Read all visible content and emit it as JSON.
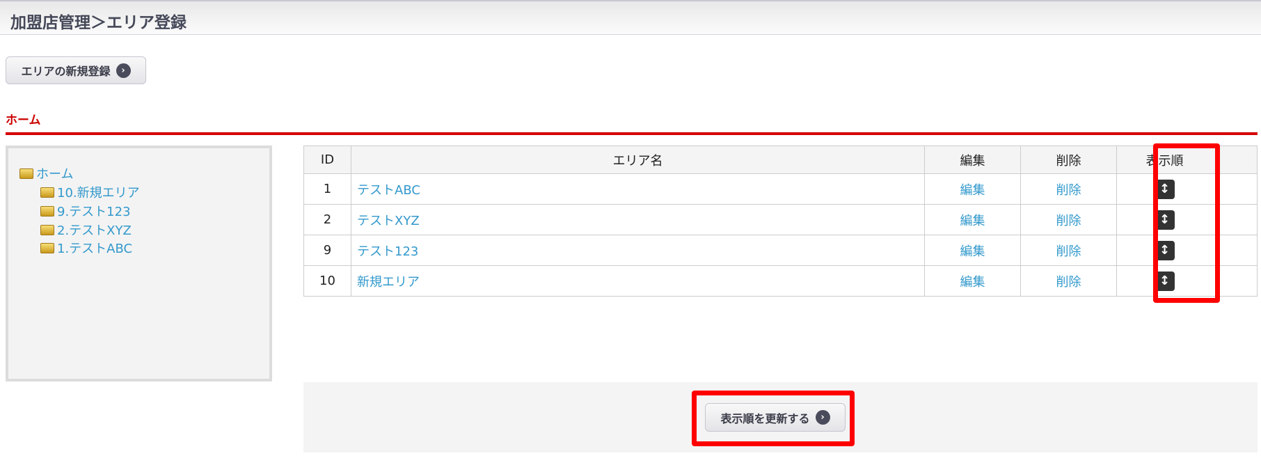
{
  "header": {
    "title": "加盟店管理＞エリア登録"
  },
  "new_button": {
    "label": "エリアの新規登録"
  },
  "section_title": "ホーム",
  "tree": {
    "root": "ホーム",
    "children": [
      "10.新規エリア",
      "9.テスト123",
      "2.テストXYZ",
      "1.テストABC"
    ]
  },
  "table": {
    "headers": [
      "ID",
      "エリア名",
      "編集",
      "削除",
      "表示順"
    ],
    "rows": [
      {
        "id": "1",
        "name": "テストABC",
        "edit": "編集",
        "delete": "削除"
      },
      {
        "id": "2",
        "name": "テストXYZ",
        "edit": "編集",
        "delete": "削除"
      },
      {
        "id": "9",
        "name": "テスト123",
        "edit": "編集",
        "delete": "削除"
      },
      {
        "id": "10",
        "name": "新規エリア",
        "edit": "編集",
        "delete": "削除"
      }
    ]
  },
  "update_button": {
    "label": "表示順を更新する"
  },
  "icons": {
    "arrow": "chevron-right-circle-icon",
    "sort": "drag-vertical-icon",
    "folder": "folder-icon"
  },
  "colors": {
    "highlight": "#ff0000",
    "accent": "#d40000",
    "link": "#3399cc"
  }
}
